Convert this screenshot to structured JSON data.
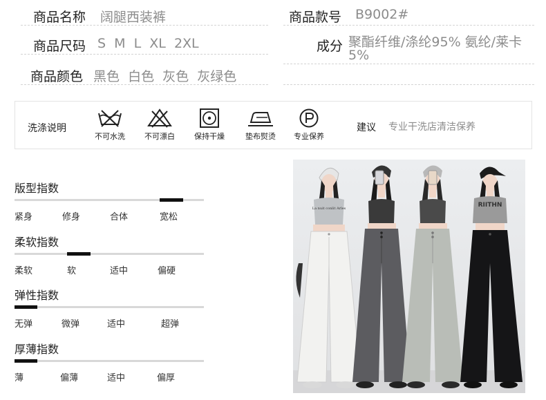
{
  "product": {
    "name_label": "商品名称",
    "name_value": "阔腿西装裤",
    "code_label": "商品款号",
    "code_value": "B9002#",
    "size_label": "商品尺码",
    "size_value": "S  M  L  XL  2XL",
    "material_label": "成分",
    "material_value": "聚酯纤维/涤纶95% 氨纶/莱卡5%",
    "color_label": "商品颜色",
    "color_value": "黑色  白色  灰色  灰绿色"
  },
  "wash": {
    "title": "洗涤说明",
    "items": [
      {
        "icon": "no-water-wash-icon",
        "label": "不可水洗"
      },
      {
        "icon": "no-bleach-icon",
        "label": "不可漂白"
      },
      {
        "icon": "tumble-dry-icon",
        "label": "保持干燥"
      },
      {
        "icon": "iron-with-cloth-icon",
        "label": "垫布熨烫"
      },
      {
        "icon": "professional-care-icon",
        "label": "专业保养"
      }
    ],
    "suggest_label": "建议",
    "suggest_value": "专业干洗店清洁保养"
  },
  "indexes": [
    {
      "title": "版型指数",
      "labels": [
        "紧身",
        "修身",
        "合体",
        "宽松"
      ],
      "selected": 3
    },
    {
      "title": "柔软指数",
      "labels": [
        "柔软",
        "软",
        "适中",
        "偏硬"
      ],
      "selected": 1
    },
    {
      "title": "弹性指数",
      "labels": [
        "无弹",
        "微弹",
        "适中",
        "超弹"
      ],
      "selected": 0
    },
    {
      "title": "厚薄指数",
      "labels": [
        "薄",
        "偏薄",
        "适中",
        "偏厚"
      ],
      "selected": 0
    }
  ],
  "photo": {
    "shirt_text_1": "La nuit conlit Arles",
    "shirt_text_2": "RIITHN"
  }
}
